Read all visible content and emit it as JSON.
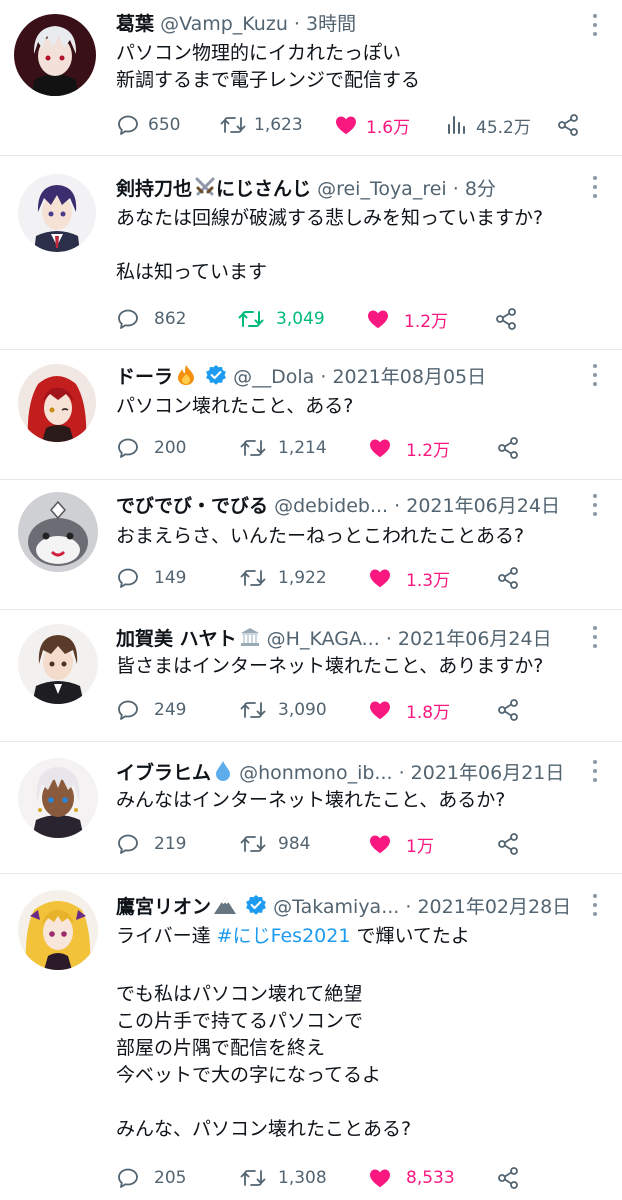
{
  "tweets": [
    {
      "name": "葛葉",
      "handle": "@Vamp_Kuzu",
      "time": "3時間",
      "text": "パソコン物理的にイカれたっぽい\n新調するまで電子レンジで配信する",
      "replies": "650",
      "retweets": "1,623",
      "likes": "1.6万",
      "views": "45.2万"
    },
    {
      "name": "剣持刀也",
      "name_suffix": "にじさんじ",
      "emoji": "crossed-swords",
      "handle": "@rei_Toya_rei",
      "time": "8分",
      "text": "あなたは回線が破滅する悲しみを知っていますか?\n\n私は知っています",
      "replies": "862",
      "retweets": "3,049",
      "likes": "1.2万"
    },
    {
      "name": "ドーラ",
      "emoji": "fire",
      "verified": true,
      "handle": "@__Dola",
      "time": "2021年08月05日",
      "text": "パソコン壊れたこと、ある?",
      "replies": "200",
      "retweets": "1,214",
      "likes": "1.2万"
    },
    {
      "name": "でびでび・でびる",
      "handle": "@debideb...",
      "time": "2021年06月24日",
      "text": "おまえらさ、いんたーねっとこわれたことある?",
      "replies": "149",
      "retweets": "1,922",
      "likes": "1.3万"
    },
    {
      "name": "加賀美 ハヤト",
      "emoji": "classical-building",
      "handle": "@H_KAGA...",
      "time": "2021年06月24日",
      "text": "皆さまはインターネット壊れたこと、ありますか?",
      "replies": "249",
      "retweets": "3,090",
      "likes": "1.8万"
    },
    {
      "name": "イブラヒム",
      "emoji": "droplet",
      "handle": "@honmono_ib...",
      "time": "2021年06月21日",
      "text": "みんなはインターネット壊れたこと、あるか?",
      "replies": "219",
      "retweets": "984",
      "likes": "1万"
    },
    {
      "name": "鷹宮リオン",
      "emoji": "mountain",
      "verified": true,
      "handle": "@Takamiya...",
      "time": "2021年02月28日",
      "text_before": "ライバー達 ",
      "hashtag": "#にじFes2021",
      "text_after": " で輝いてたよ",
      "text": "でも私はパソコン壊れて絶望\nこの片手で持てるパソコンで\n部屋の片隅で配信を終え\n今ベットで大の字になってるよ\n\nみんな、パソコン壊れたことある?",
      "replies": "205",
      "retweets": "1,308",
      "likes": "8,533"
    }
  ],
  "separator": "·",
  "colors": {
    "like": "#f91880",
    "retweet_active": "#00ba7c",
    "verified": "#1d9bf0",
    "hashtag": "#1d9bf0",
    "muted": "#536471"
  },
  "icons": [
    "reply-icon",
    "retweet-icon",
    "heart-icon",
    "views-icon",
    "share-icon",
    "more-icon",
    "verified-badge-icon"
  ]
}
